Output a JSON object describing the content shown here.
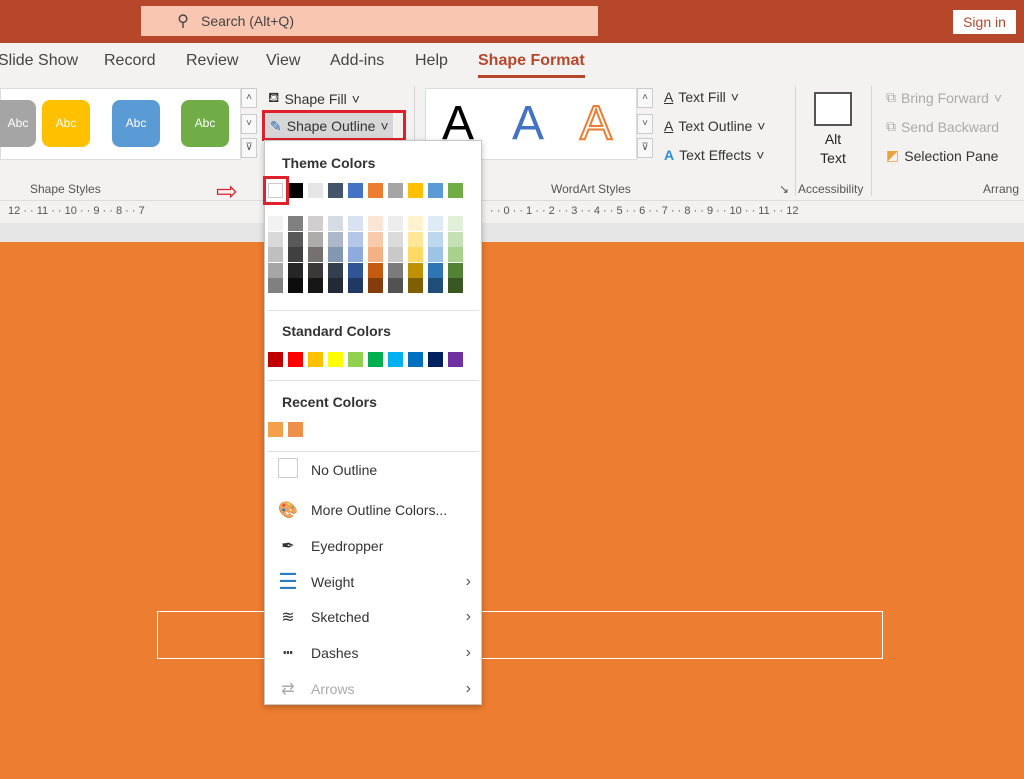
{
  "titlebar": {
    "search_placeholder": "Search (Alt+Q)",
    "sign_in": "Sign in"
  },
  "tabs": [
    "Slide Show",
    "Record",
    "Review",
    "View",
    "Add-ins",
    "Help",
    "Shape Format"
  ],
  "active_tab": "Shape Format",
  "ribbon": {
    "shape_styles": {
      "label": "Shape Styles",
      "presets": [
        {
          "text": "Abc",
          "color": "#a5a5a5"
        },
        {
          "text": "Abc",
          "color": "#ffc000"
        },
        {
          "text": "Abc",
          "color": "#5b9bd5"
        },
        {
          "text": "Abc",
          "color": "#70ad47"
        }
      ],
      "shape_fill": "Shape Fill",
      "shape_outline": "Shape Outline"
    },
    "wordart": {
      "label": "WordArt Styles",
      "letters": [
        "A",
        "A",
        "A"
      ],
      "text_fill": "Text Fill",
      "text_outline": "Text Outline",
      "text_effects": "Text Effects"
    },
    "accessibility": {
      "label": "Accessibility",
      "alt_text_1": "Alt",
      "alt_text_2": "Text"
    },
    "arrange": {
      "label": "Arrang",
      "bring_forward": "Bring Forward",
      "send_backward": "Send Backward",
      "selection_pane": "Selection Pane"
    }
  },
  "ruler": {
    "left": "12 · · 11 · · 10 · · 9 · · 8 · · 7",
    "right": "· · 0 · · 1 · · 2 · · 3 · · 4 · · 5 · · 6 · · 7 · · 8 · · 9 · · 10 · · 11 · · 12"
  },
  "menu": {
    "theme_colors_label": "Theme Colors",
    "theme_colors": [
      "#ffffff",
      "#000000",
      "#e7e6e6",
      "#44546a",
      "#4472c4",
      "#ed7d31",
      "#a5a5a5",
      "#ffc000",
      "#5b9bd5",
      "#70ad47"
    ],
    "theme_tints": [
      [
        "#f2f2f2",
        "#d9d9d9",
        "#bfbfbf",
        "#a6a6a6",
        "#808080"
      ],
      [
        "#808080",
        "#595959",
        "#404040",
        "#262626",
        "#0d0d0d"
      ],
      [
        "#d0cece",
        "#aeabab",
        "#757171",
        "#3b3838",
        "#161616"
      ],
      [
        "#d6dce4",
        "#adb9ca",
        "#8497b0",
        "#333f4f",
        "#222a35"
      ],
      [
        "#d9e2f3",
        "#b4c7e7",
        "#8faadc",
        "#2f5597",
        "#203864"
      ],
      [
        "#fbe5d6",
        "#f8cbad",
        "#f4b183",
        "#c55a11",
        "#843c0c"
      ],
      [
        "#ededed",
        "#dbdbdb",
        "#c9c9c9",
        "#7b7b7b",
        "#525252"
      ],
      [
        "#fff2cc",
        "#ffe699",
        "#ffd966",
        "#bf9000",
        "#7f6000"
      ],
      [
        "#deebf7",
        "#bdd7ee",
        "#9dc3e6",
        "#2e75b6",
        "#1f4e79"
      ],
      [
        "#e2f0d9",
        "#c5e0b4",
        "#a9d18e",
        "#548235",
        "#385723"
      ]
    ],
    "standard_colors_label": "Standard Colors",
    "standard_colors": [
      "#c00000",
      "#ff0000",
      "#ffc000",
      "#ffff00",
      "#92d050",
      "#00b050",
      "#00b0f0",
      "#0070c0",
      "#002060",
      "#7030a0"
    ],
    "recent_colors_label": "Recent Colors",
    "recent_colors": [
      "#f4a04a",
      "#ee8f4b"
    ],
    "items": [
      {
        "label": "No Outline",
        "icon": "empty-square-icon",
        "submenu": false,
        "disabled": false
      },
      {
        "label": "More Outline Colors...",
        "icon": "palette-icon",
        "submenu": false,
        "disabled": false
      },
      {
        "label": "Eyedropper",
        "icon": "eyedropper-icon",
        "submenu": false,
        "disabled": false
      },
      {
        "label": "Weight",
        "icon": "line-weight-icon",
        "submenu": true,
        "disabled": false
      },
      {
        "label": "Sketched",
        "icon": "sketched-line-icon",
        "submenu": true,
        "disabled": false
      },
      {
        "label": "Dashes",
        "icon": "dashes-icon",
        "submenu": true,
        "disabled": false
      },
      {
        "label": "Arrows",
        "icon": "arrows-icon",
        "submenu": true,
        "disabled": true
      }
    ]
  },
  "colors": {
    "accent": "#b7472a",
    "slide": "#ed7d31",
    "highlight": "#e0202a"
  }
}
